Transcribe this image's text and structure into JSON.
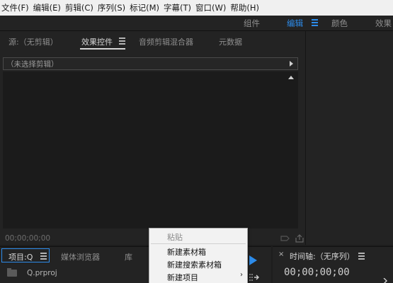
{
  "menubar": {
    "items": [
      "文件(F)",
      "编辑(E)",
      "剪辑(C)",
      "序列(S)",
      "标记(M)",
      "字幕(T)",
      "窗口(W)",
      "帮助(H)"
    ]
  },
  "workspaces": {
    "tabs": [
      {
        "label": "组件",
        "active": false
      },
      {
        "label": "编辑",
        "active": true
      },
      {
        "label": "颜色",
        "active": false
      },
      {
        "label": "效果",
        "active": false
      }
    ]
  },
  "source_panel": {
    "tabs": [
      {
        "label": "源:（无剪辑）",
        "active": false
      },
      {
        "label": "效果控件",
        "active": true
      },
      {
        "label": "音频剪辑混合器",
        "active": false
      },
      {
        "label": "元数据",
        "active": false
      }
    ],
    "clip_selector": "（未选择剪辑）",
    "timecode": "00;00;00;00"
  },
  "project_panel": {
    "tabs": [
      {
        "label": "项目:Q",
        "active": true
      },
      {
        "label": "媒体浏览器",
        "active": false
      },
      {
        "label": "库",
        "active": false
      }
    ],
    "file_name": "Q.prproj"
  },
  "context_menu": {
    "items": [
      {
        "label": "粘贴",
        "enabled": false,
        "submenu": false
      },
      {
        "label": "新建素材箱",
        "enabled": true,
        "submenu": false
      },
      {
        "label": "新建搜索素材箱",
        "enabled": true,
        "submenu": false
      },
      {
        "label": "新建项目",
        "enabled": true,
        "submenu": true
      }
    ],
    "submenu_arrow": "›"
  },
  "timeline_panel": {
    "close_glyph": "×",
    "title": "时间轴:（无序列）",
    "timecode": "00;00;00;00"
  },
  "colors": {
    "accent": "#2d8ceb",
    "panel_bg": "#232323",
    "menubar_bg": "#f0f0f0"
  }
}
